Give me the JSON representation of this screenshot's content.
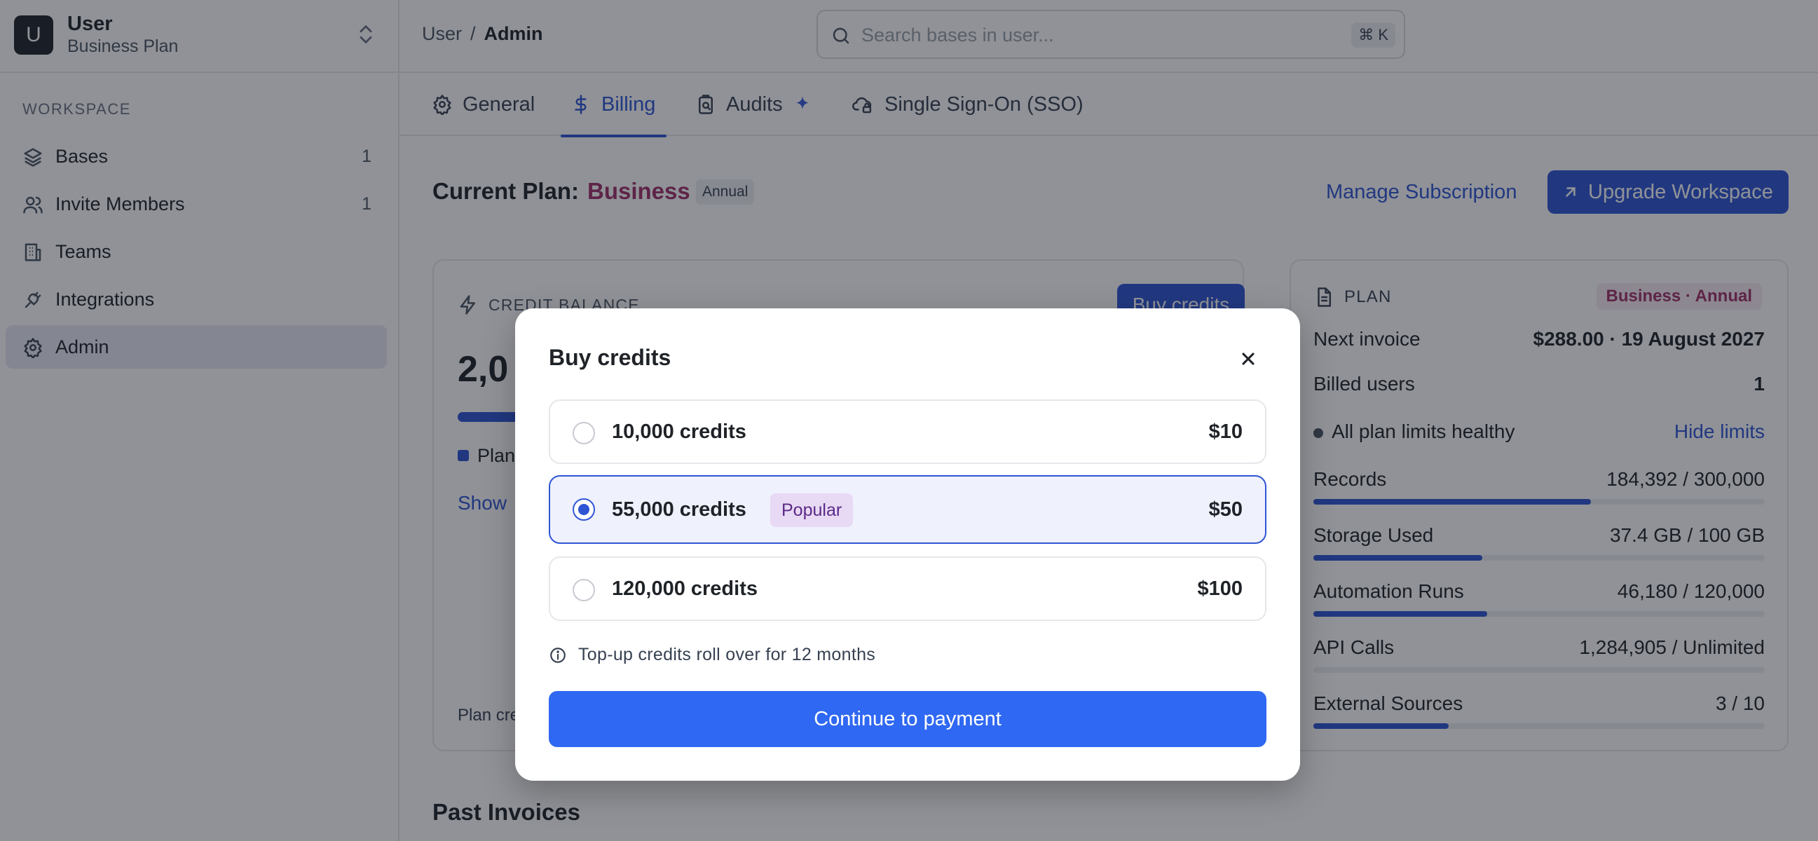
{
  "workspace": {
    "avatar_letter": "U",
    "name": "User",
    "plan": "Business Plan"
  },
  "sidebar": {
    "section_label": "WORKSPACE",
    "items": [
      {
        "label": "Bases",
        "count": "1",
        "icon": "layers-icon"
      },
      {
        "label": "Invite Members",
        "count": "1",
        "icon": "users-icon"
      },
      {
        "label": "Teams",
        "icon": "building-icon"
      },
      {
        "label": "Integrations",
        "icon": "plug-icon"
      },
      {
        "label": "Admin",
        "icon": "gear-icon",
        "active": true
      }
    ]
  },
  "header": {
    "breadcrumb": [
      "User",
      "Admin"
    ],
    "breadcrumb_sep": "/",
    "search": {
      "placeholder": "Search bases in user...",
      "shortcut": "⌘ K"
    }
  },
  "tabs": [
    {
      "label": "General",
      "icon": "gear-icon"
    },
    {
      "label": "Billing",
      "icon": "dollar-icon",
      "active": true
    },
    {
      "label": "Audits",
      "icon": "clipboard-search-icon",
      "badge_icon": "sparkle-icon"
    },
    {
      "label": "Single Sign-On (SSO)",
      "icon": "cloud-lock-icon"
    }
  ],
  "billing": {
    "current_plan_label": "Current Plan:",
    "plan_name": "Business",
    "plan_cycle_badge": "Annual",
    "manage_label": "Manage Subscription",
    "upgrade_label": "Upgrade Workspace",
    "credit_card": {
      "title": "CREDIT BALANCE",
      "buy_label": "Buy credits",
      "amount_partial": "2,0",
      "legend_partial": "Plan",
      "show_partial": "Show",
      "footer_partial": "Plan cre"
    },
    "plan_card": {
      "title": "PLAN",
      "badge": "Business · Annual",
      "next_invoice_label": "Next invoice",
      "next_invoice_value": "$288.00 · 19 August 2027",
      "billed_users_label": "Billed users",
      "billed_users_value": "1",
      "limits_status": "All plan limits healthy",
      "hide_limits_label": "Hide limits",
      "limits": [
        {
          "label": "Records",
          "value": "184,392 / 300,000",
          "usage": 0.6146
        },
        {
          "label": "Storage Used",
          "value": "37.4 GB / 100 GB",
          "usage": 0.374
        },
        {
          "label": "Automation Runs",
          "value": "46,180 / 120,000",
          "usage": 0.3848
        },
        {
          "label": "API Calls",
          "value": "1,284,905 / Unlimited",
          "usage": 0
        },
        {
          "label": "External Sources",
          "value": "3 / 10",
          "usage": 0.3
        }
      ]
    },
    "past_invoices_title": "Past Invoices"
  },
  "modal": {
    "title": "Buy credits",
    "options": [
      {
        "label": "10,000 credits",
        "price": "$10"
      },
      {
        "label": "55,000 credits",
        "price": "$50",
        "badge": "Popular",
        "selected": true
      },
      {
        "label": "120,000 credits",
        "price": "$100"
      }
    ],
    "note": "Top-up credits roll over for 12 months",
    "continue_label": "Continue to payment"
  },
  "colors": {
    "accent": "#2f55d4",
    "brand_plan": "#a0306b",
    "continue_button": "#2f68f2"
  }
}
